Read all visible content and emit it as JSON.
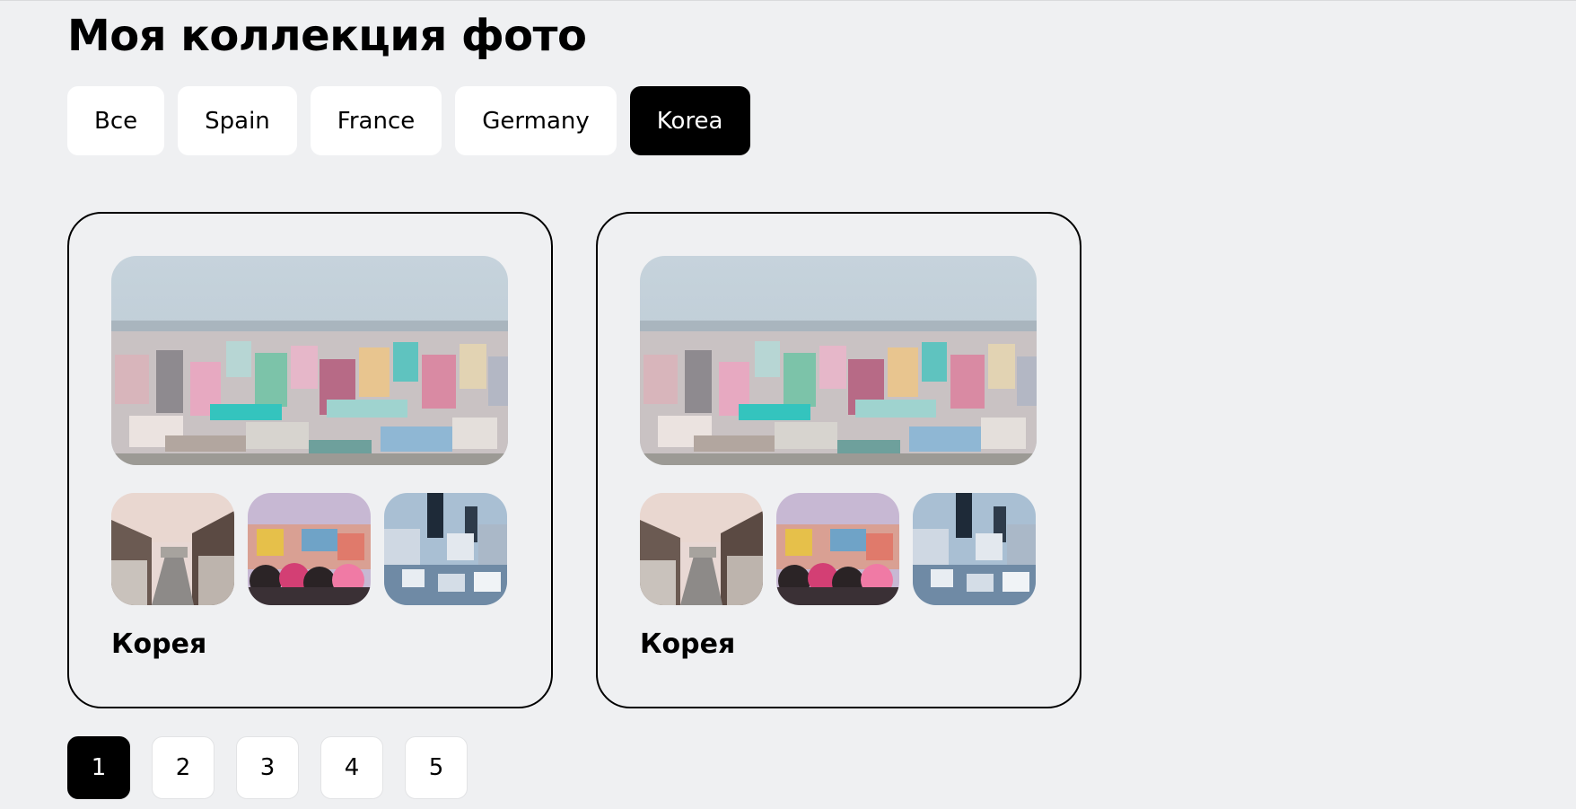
{
  "page": {
    "title": "Моя коллекция фото"
  },
  "filters": [
    {
      "label": "Все",
      "active": false
    },
    {
      "label": "Spain",
      "active": false
    },
    {
      "label": "France",
      "active": false
    },
    {
      "label": "Germany",
      "active": false
    },
    {
      "label": "Korea",
      "active": true
    }
  ],
  "cards": [
    {
      "caption": "Корея",
      "main_photo": "city-skyline-photo",
      "thumbnails": [
        "hanok-village-street-photo",
        "mural-crowd-photo",
        "city-buildings-photo"
      ]
    },
    {
      "caption": "Корея",
      "main_photo": "city-skyline-photo",
      "thumbnails": [
        "hanok-village-street-photo",
        "mural-crowd-photo",
        "city-buildings-photo"
      ]
    }
  ],
  "pagination": {
    "pages": [
      "1",
      "2",
      "3",
      "4",
      "5"
    ],
    "current": "1"
  },
  "colors": {
    "background": "#eff0f2",
    "active": "#000000",
    "chip": "#ffffff"
  }
}
